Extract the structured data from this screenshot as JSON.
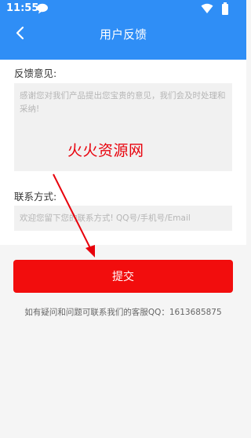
{
  "status_bar": {
    "time": "11:55",
    "icons": [
      "chat-bubble-icon",
      "wifi-icon",
      "battery-icon"
    ]
  },
  "header": {
    "title": "用户反馈",
    "back_icon": "chevron-left-icon"
  },
  "form": {
    "feedback_label": "反馈意见:",
    "feedback_placeholder": "感谢您对我们产品提出您宝贵的意见，我们会及时处理和采纳!",
    "contact_label": "联系方式:",
    "contact_placeholder": "欢迎您留下您的联系方式! QQ号/手机号/Email"
  },
  "overlay": {
    "watermark": "火火资源网"
  },
  "submit_label": "提交",
  "footer_note": "如有疑问和问题可联系我们的客服QQ：1613685875",
  "colors": {
    "app_bar": "#2f8ef6",
    "submit": "#f20d0d",
    "watermark": "#e8000b",
    "input_bg": "#f1f1f1",
    "page_bg": "#f5f5f5"
  }
}
